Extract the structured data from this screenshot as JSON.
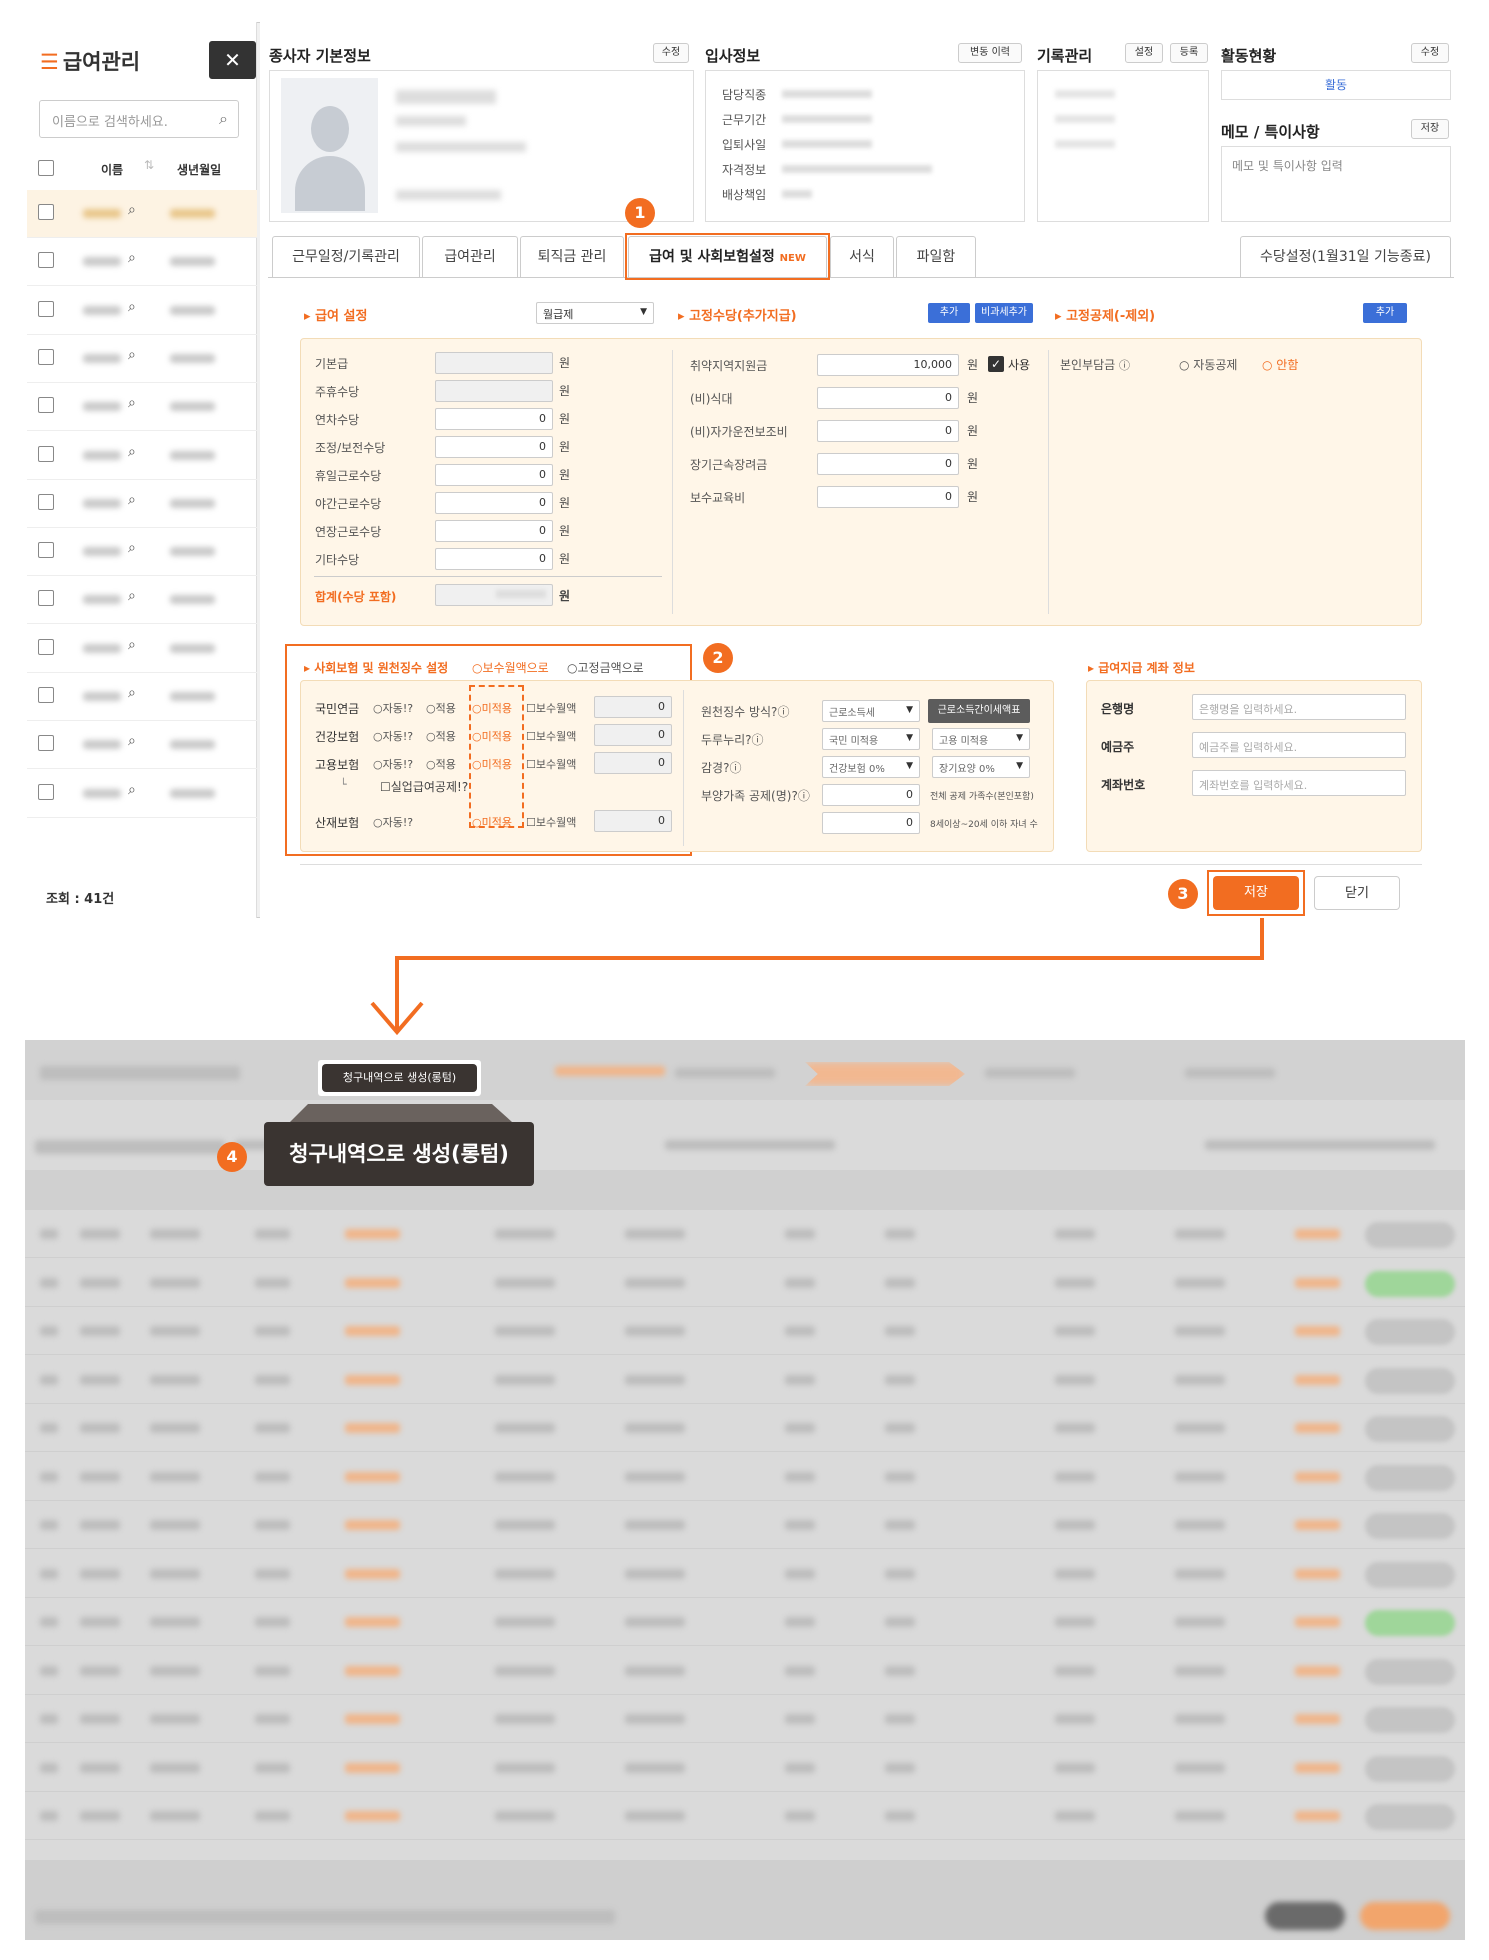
{
  "app": {
    "title": "급여관리",
    "close": "✕",
    "search_placeholder": "이름으로 검색하세요.",
    "col_name": "이름",
    "col_birth": "생년월일",
    "count_label": "조회 : 41건"
  },
  "employee": {
    "basic_title": "종사자 기본정보",
    "edit": "수정",
    "hire_title": "입사정보",
    "change_history": "변동 이력",
    "hire_labels": [
      "담당직종",
      "근무기간",
      "입퇴사일",
      "자격정보",
      "배상책임"
    ],
    "record_title": "기록관리",
    "setting": "설정",
    "register": "등록",
    "activity_title": "활동현황",
    "activity_edit": "수정",
    "activity_value": "활동",
    "memo_title": "메모 / 특이사항",
    "memo_save": "저장",
    "memo_placeholder": "메모 및 특이사항 입력"
  },
  "tabs": [
    "근무일정/기록관리",
    "급여관리",
    "퇴직금 관리",
    "급여 및 사회보험설정",
    "서식",
    "파일함",
    "수당설정(1월31일 기능종료)"
  ],
  "new_badge": "NEW",
  "salary": {
    "title": "급여 설정",
    "pay_type": "월급제",
    "items": [
      "기본급",
      "주휴수당",
      "연차수당",
      "조정/보전수당",
      "휴일근로수당",
      "야간근로수당",
      "연장근로수당",
      "기타수당"
    ],
    "values": [
      "",
      "",
      "0",
      "0",
      "0",
      "0",
      "0",
      "0"
    ],
    "unit": "원",
    "total_label": "합계(수당 포함)"
  },
  "allowance": {
    "title": "고정수당(추가지급)",
    "add": "추가",
    "nontax_add": "비과세추가",
    "items": [
      "취약지역지원금",
      "(비)식대",
      "(비)자가운전보조비",
      "장기근속장려금",
      "보수교육비"
    ],
    "values": [
      "10,000",
      "0",
      "0",
      "0",
      "0"
    ],
    "use": "사용"
  },
  "deduction": {
    "title": "고정공제(-제외)",
    "add": "추가",
    "label": "본인부담금",
    "opt_auto": "자동공제",
    "opt_none": "안함"
  },
  "insurance": {
    "title": "사회보험 및 원천징수 설정",
    "opt_salary": "보수월액으로",
    "opt_fixed": "고정금액으로",
    "rows": [
      "국민연금",
      "건강보험",
      "고용보험",
      "산재보험"
    ],
    "auto": "자동!?",
    "apply": "적용",
    "noapply": "미적용",
    "salary_month": "보수월액",
    "unemp": "실업급여공제!?",
    "zero": "0"
  },
  "withholding": {
    "method_label": "원천징수 방식?",
    "method_value": "근로소득세",
    "simple_btn": "근로소득간이세액표",
    "durunuri": "두루누리?",
    "dur1": "국민 미적용",
    "dur2": "고용 미적용",
    "reduce": "감경?",
    "red1": "건강보험 0%",
    "red2": "장기요양 0%",
    "dep_label": "부양가족 공제(명)?",
    "dep1": "0",
    "dep2": "0",
    "dep1_note": "전체 공제 가족수(본인포함)",
    "dep2_note": "8세이상~20세 이하 자녀 수"
  },
  "bank": {
    "title": "급여지급 계좌 정보",
    "bank_label": "은행명",
    "bank_ph": "은행명을 입력하세요.",
    "owner_label": "예금주",
    "owner_ph": "예금주를 입력하세요.",
    "acct_label": "계좌번호",
    "acct_ph": "계좌번호를 입력하세요."
  },
  "actions": {
    "save": "저장",
    "close": "닫기"
  },
  "steps": [
    "1",
    "2",
    "3",
    "4"
  ],
  "lower": {
    "top_button": "청구내역으로 생성(롱텀)",
    "callout": "청구내역으로 생성(롱텀)"
  },
  "colors": {
    "accent": "#f26d21",
    "blue": "#3b6fd8",
    "dark": "#333333"
  }
}
